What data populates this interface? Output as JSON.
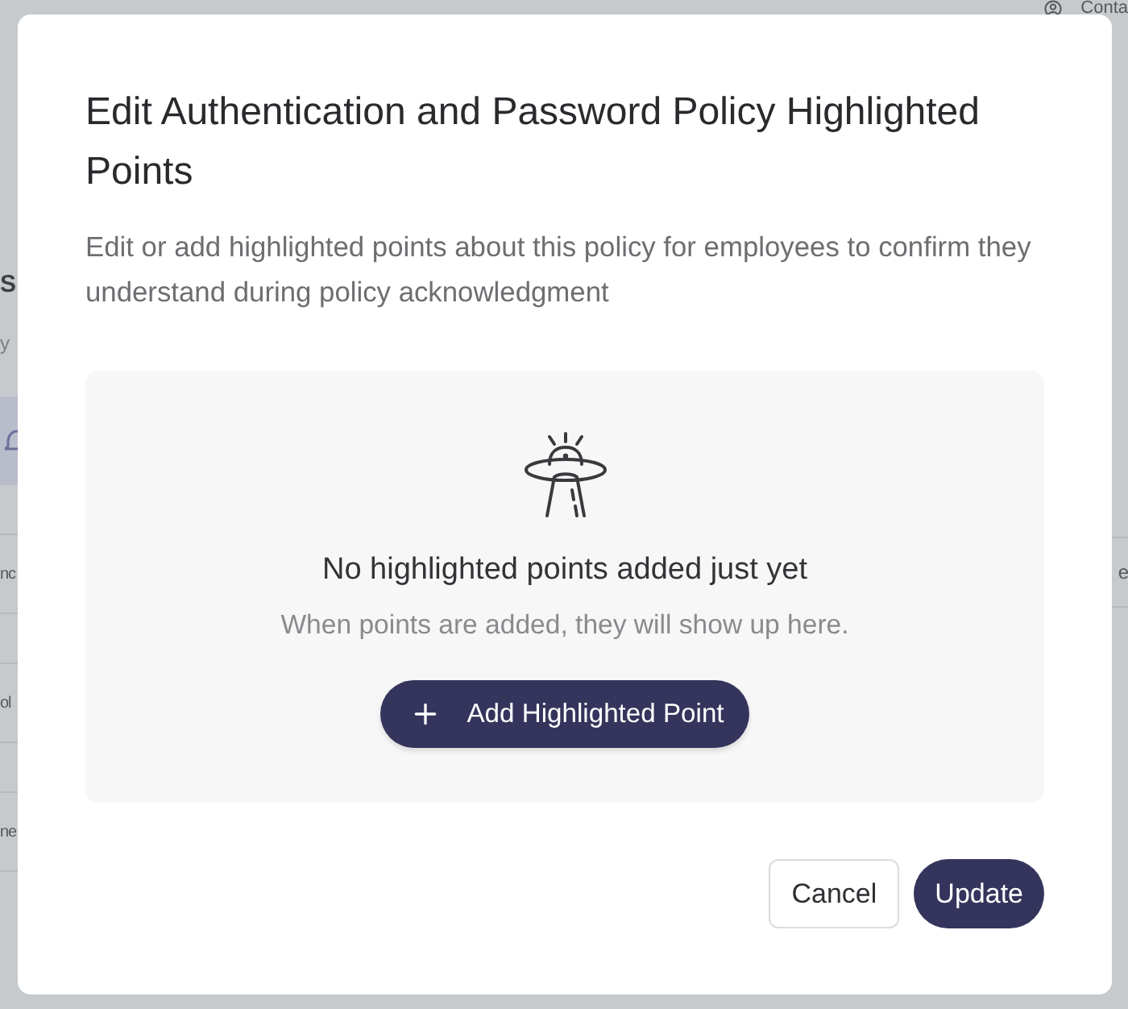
{
  "background_page": {
    "account": {
      "label": "Conta"
    },
    "left_fragments": [
      {
        "kind": "heading",
        "text": "S"
      },
      {
        "kind": "subtitle",
        "text": "y"
      },
      {
        "kind": "nav"
      },
      {
        "kind": "row",
        "text": "nc"
      },
      {
        "kind": "row",
        "text": "ol"
      },
      {
        "kind": "row",
        "text": "ne"
      }
    ],
    "right_fragments": [
      {
        "kind": "row",
        "text": "e"
      }
    ]
  },
  "dialog": {
    "title": "Edit Authentication and Password Policy Highlighted Points",
    "description": "Edit or add highlighted points about this policy for employees to confirm they understand during policy acknowledgment",
    "empty_state": {
      "heading": "No highlighted points added just yet",
      "message": "When points are added, they will show up here.",
      "button": "Add Highlighted Point"
    },
    "buttons": [
      {
        "label": "Cancel",
        "kind": "secondary"
      },
      {
        "label": "Update",
        "kind": "primary"
      }
    ]
  }
}
